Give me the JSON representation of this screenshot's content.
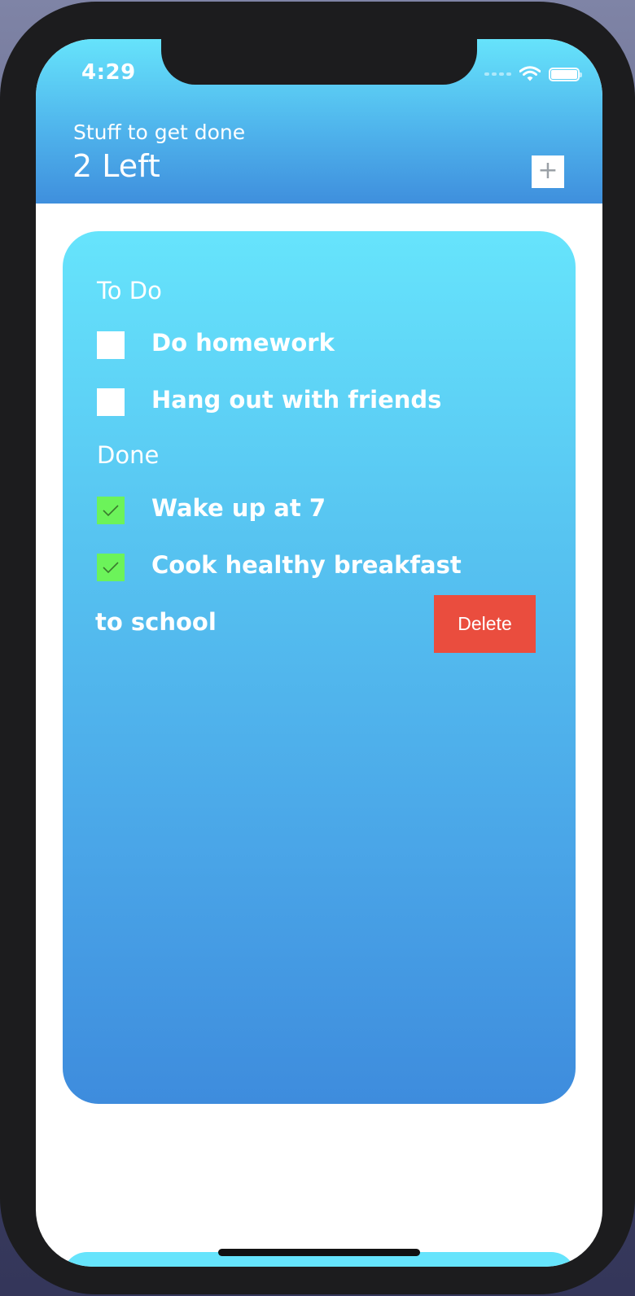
{
  "status_bar": {
    "time": "4:29",
    "icons": [
      "cellular-signal-icon",
      "wifi-icon",
      "battery-icon"
    ]
  },
  "header": {
    "subtitle": "Stuff to get done",
    "count_label": "2 Left",
    "add_button_label": "+"
  },
  "sections": {
    "todo": {
      "title": "To Do",
      "items": [
        {
          "label": "Do homework",
          "done": false
        },
        {
          "label": "Hang out with friends",
          "done": false
        }
      ]
    },
    "done": {
      "title": "Done",
      "items": [
        {
          "label": "Wake up at 7",
          "done": true
        },
        {
          "label": "Cook healthy breakfast",
          "done": true
        }
      ]
    }
  },
  "swiped_row": {
    "visible_text": "to school",
    "delete_label": "Delete"
  },
  "colors": {
    "gradient_top": "#66e3fb",
    "gradient_bottom": "#3e8cdd",
    "checked_green": "#6cf35a",
    "delete_red": "#ea4d3e"
  }
}
